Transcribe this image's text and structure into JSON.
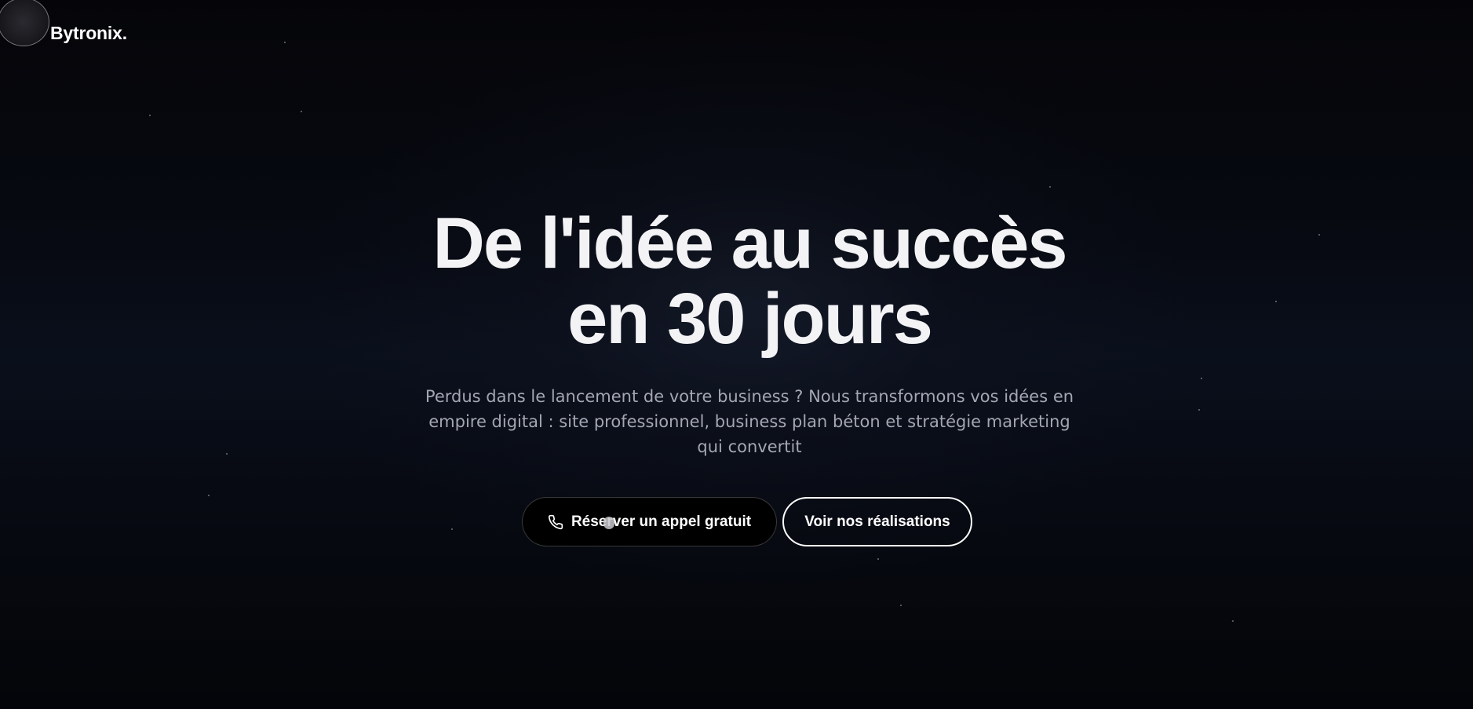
{
  "brand": {
    "name": "Bytronix."
  },
  "hero": {
    "title_line1": "De l'idée au succès",
    "title_line2": "en 30 jours",
    "subtitle": "Perdus dans le lancement de votre business ? Nous transformons vos idées en empire digital : site professionnel, business plan béton et stratégie marketing qui convertit"
  },
  "actions": {
    "primary_label": "Réserver un appel gratuit",
    "primary_icon": "phone-icon",
    "secondary_label": "Voir nos réalisations"
  },
  "colors": {
    "background": "#040509",
    "text_primary": "#f3f3f5",
    "text_secondary": "#a4a7b2",
    "button_primary_bg": "#000000",
    "button_secondary_border": "#ffffff"
  }
}
